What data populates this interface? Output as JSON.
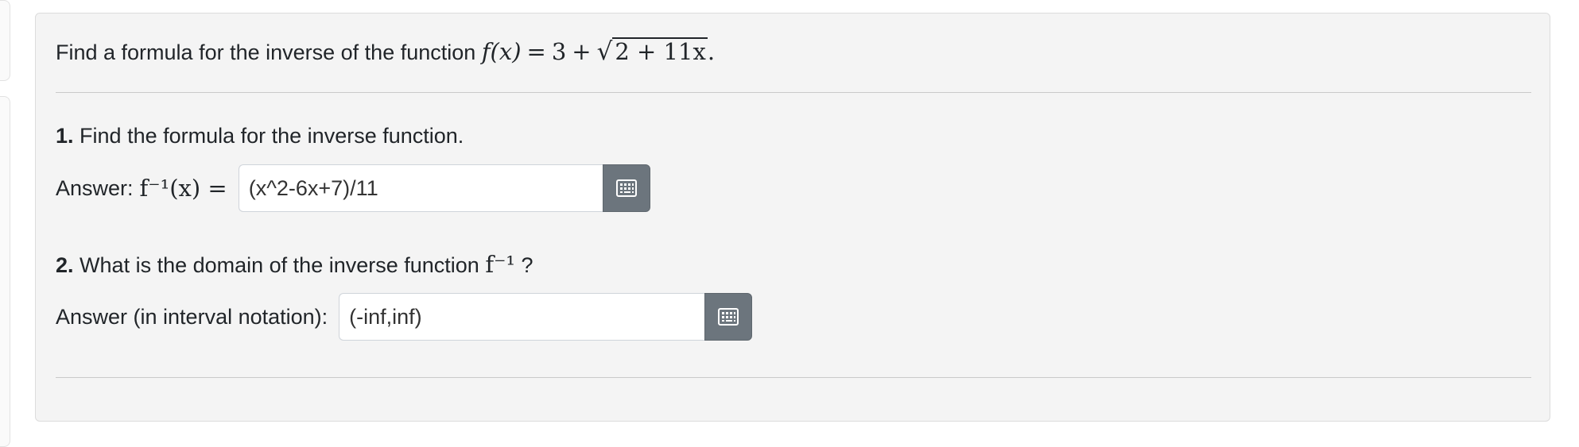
{
  "problem": {
    "prompt_prefix": "Find a formula for the inverse of the function",
    "function_lhs": "f(x)",
    "function_rhs_const": "3",
    "function_radicand": "2 + 11x",
    "prompt_end": "."
  },
  "questions": [
    {
      "number": "1.",
      "text": "Find the formula for the inverse function.",
      "answer_label": "Answer:",
      "answer_math": "f⁻¹(x) =",
      "answer_value": "(x^2-6x+7)/11",
      "keyboard_icon": "keyboard-icon"
    },
    {
      "number": "2.",
      "text": "What is the domain of the inverse function",
      "math_suffix": "f⁻¹",
      "text_end": "?",
      "answer_label": "Answer (in interval notation):",
      "answer_value": "(-inf,inf)",
      "keyboard_icon": "keyboard-icon"
    }
  ],
  "colors": {
    "card_background": "#f4f4f4",
    "button_gray": "#6c757d",
    "text": "#212529"
  }
}
